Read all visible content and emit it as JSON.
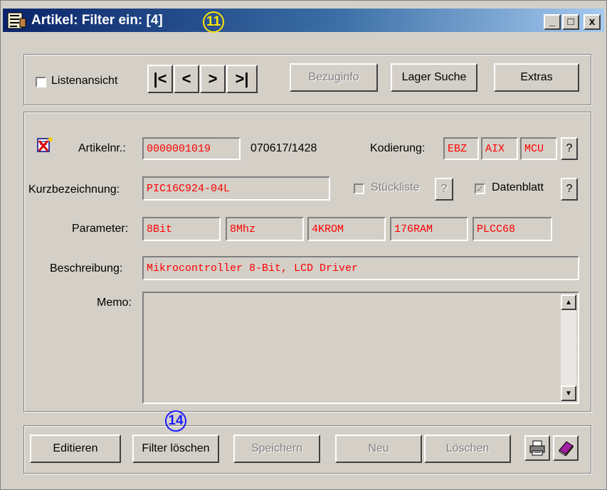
{
  "window": {
    "title": "Artikel: Filter ein:  [4]",
    "badge_title": "11",
    "minimize": "_",
    "maximize": "□",
    "close": "x"
  },
  "toolbar": {
    "list_view_label": "Listenansicht",
    "list_view_checked": false,
    "nav_first": "|<",
    "nav_prev": "<",
    "nav_next": ">",
    "nav_last": ">|",
    "bezuginfo": "Bezuginfo",
    "lager_suche": "Lager Suche",
    "extras": "Extras"
  },
  "form": {
    "artikelnr_label": "Artikelnr.:",
    "artikelnr_value": "0000001019",
    "artikelnr_date": "070617/1428",
    "kodierung_label": "Kodierung:",
    "kodierung": [
      "EBZ",
      "AIX",
      "MCU"
    ],
    "help": "?",
    "kurz_label": "Kurzbezeichnung:",
    "kurz_value": "PIC16C924-04L",
    "stueckliste_label": "Stückliste",
    "stueckliste_checked": false,
    "datenblatt_label": "Datenblatt",
    "datenblatt_checked": true,
    "parameter_label": "Parameter:",
    "parameters": [
      "8Bit",
      "8Mhz",
      "4KROM",
      "176RAM",
      "PLCC68"
    ],
    "beschreibung_label": "Beschreibung:",
    "beschreibung_value": "Mikrocontroller 8-Bit, LCD Driver",
    "memo_label": "Memo:",
    "memo_value": ""
  },
  "footer": {
    "editieren": "Editieren",
    "filter_loeschen": "Filter löschen",
    "badge_filter": "14",
    "speichern": "Speichern",
    "neu": "Neu",
    "loeschen": "Löschen"
  },
  "colors": {
    "title_start": "#0a246a",
    "title_end": "#a6caf0",
    "field_text": "#ff0000",
    "badge_title": "#ffe600",
    "badge_filter": "#1a1aff"
  },
  "icons": [
    "app-icon",
    "delete-record-icon",
    "print-icon",
    "book-icon",
    "scroll-up-icon",
    "scroll-down-icon"
  ]
}
